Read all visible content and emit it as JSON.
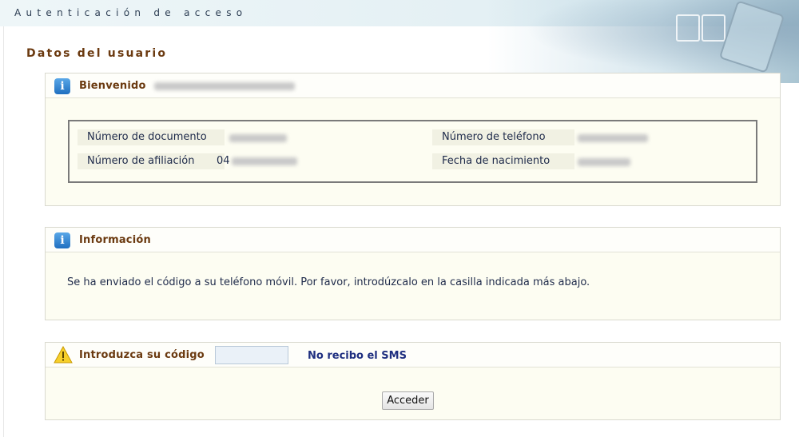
{
  "header": {
    "title": "Autenticación de acceso"
  },
  "section_title": "Datos del usuario",
  "welcome_panel": {
    "title": "Bienvenido",
    "fields": {
      "document_label": "Número de documento",
      "phone_label": "Número de teléfono",
      "affiliation_label": "Número de afiliación",
      "affiliation_prefix": "04",
      "birth_label": "Fecha de nacimiento"
    }
  },
  "info_panel": {
    "title": "Información",
    "message": "Se ha enviado el código a su teléfono móvil. Por favor, introdúzcalo en la casilla indicada más abajo."
  },
  "code_panel": {
    "title": "Introduzca su código",
    "input_value": "",
    "no_sms_link": "No recibo el SMS",
    "submit_label": "Acceder"
  },
  "icons": {
    "info": "info-icon",
    "warning": "warning-icon"
  }
}
